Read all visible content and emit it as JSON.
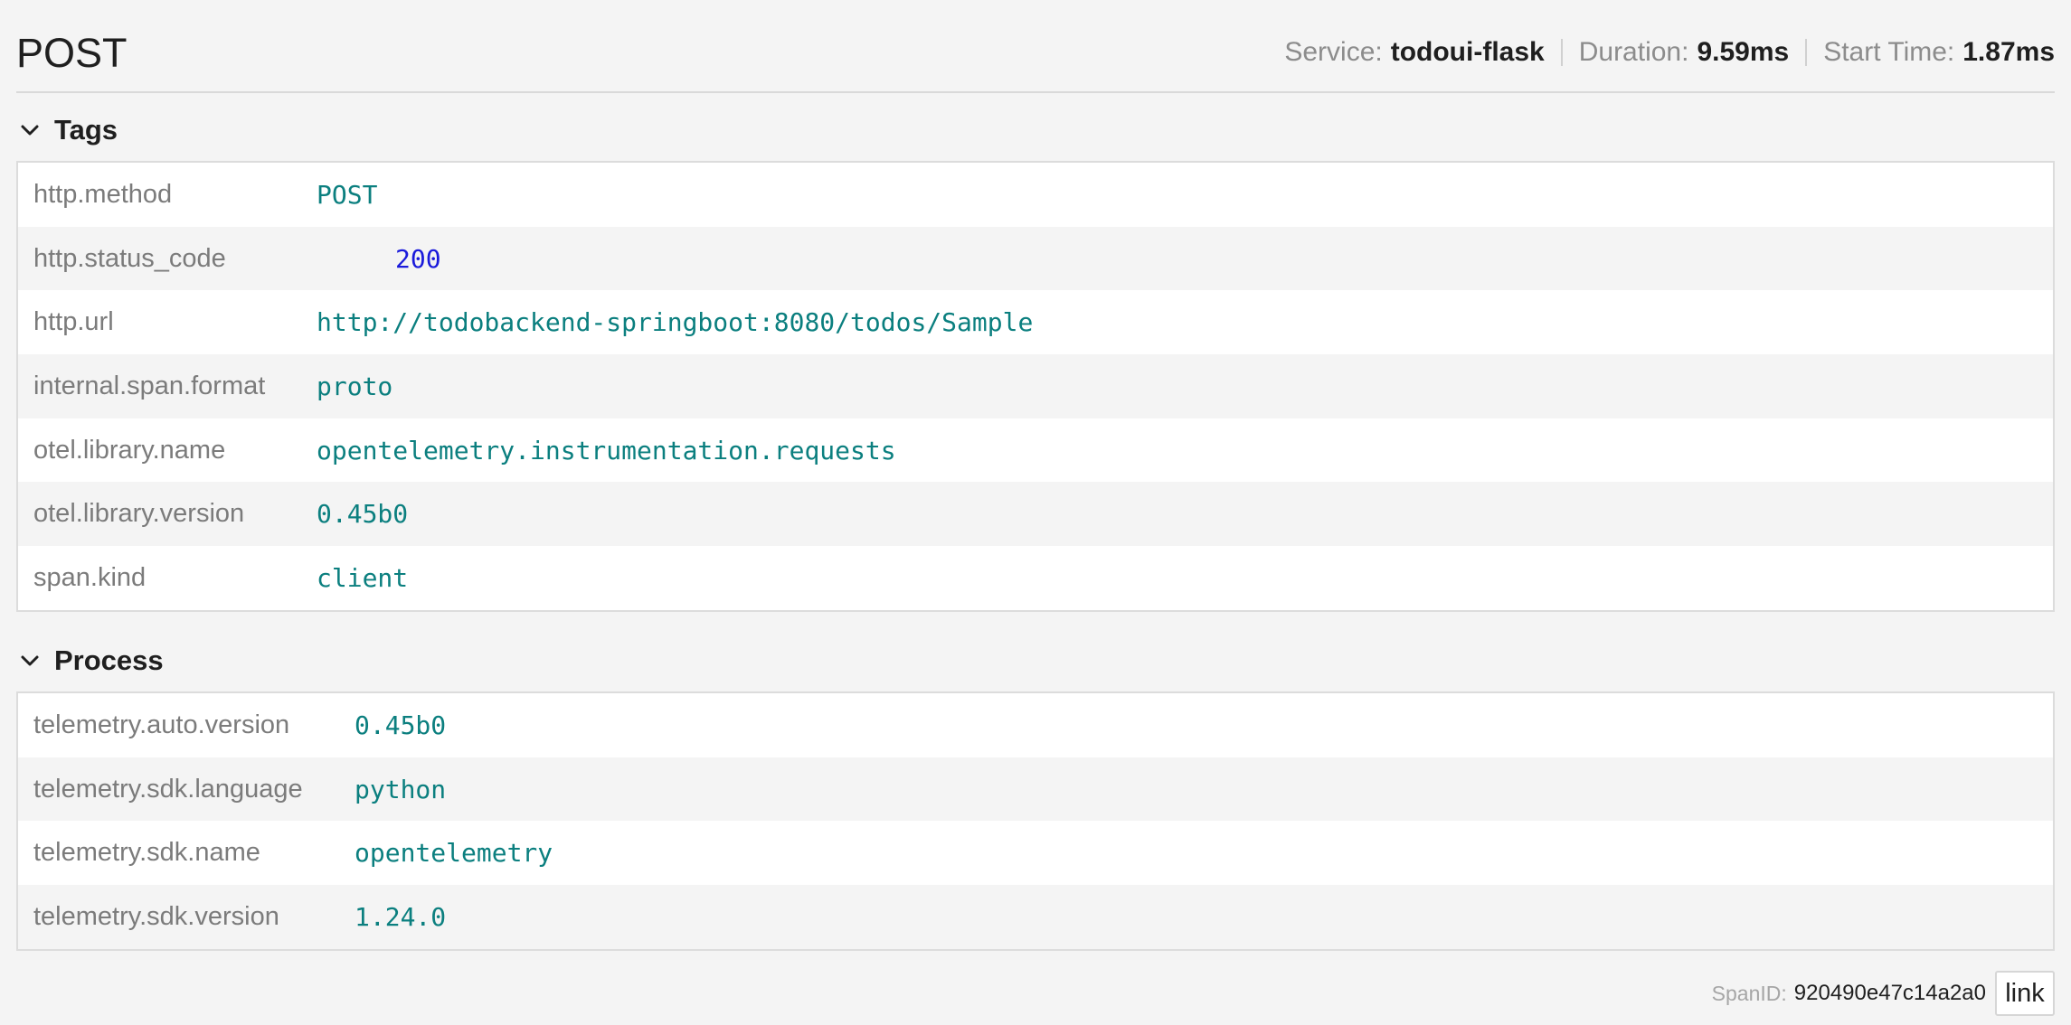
{
  "header": {
    "title": "POST",
    "service_label": "Service:",
    "service_value": "todoui-flask",
    "duration_label": "Duration:",
    "duration_value": "9.59ms",
    "start_label": "Start Time:",
    "start_value": "1.87ms"
  },
  "tags": {
    "title": "Tags",
    "rows": [
      {
        "key": "http.method",
        "value": "POST"
      },
      {
        "key": "http.status_code",
        "value": "200"
      },
      {
        "key": "http.url",
        "value": "http://todobackend-springboot:8080/todos/Sample"
      },
      {
        "key": "internal.span.format",
        "value": "proto"
      },
      {
        "key": "otel.library.name",
        "value": "opentelemetry.instrumentation.requests"
      },
      {
        "key": "otel.library.version",
        "value": "0.45b0"
      },
      {
        "key": "span.kind",
        "value": "client"
      }
    ]
  },
  "process": {
    "title": "Process",
    "rows": [
      {
        "key": "telemetry.auto.version",
        "value": "0.45b0"
      },
      {
        "key": "telemetry.sdk.language",
        "value": "python"
      },
      {
        "key": "telemetry.sdk.name",
        "value": "opentelemetry"
      },
      {
        "key": "telemetry.sdk.version",
        "value": "1.24.0"
      }
    ]
  },
  "footer": {
    "span_id_label": "SpanID:",
    "span_id_value": "920490e47c14a2a0",
    "link_label": "link"
  },
  "icons": {
    "tags_toggle": "chevron-down-icon",
    "process_toggle": "chevron-down-icon"
  },
  "colors": {
    "tag_value": "#0b7f7f",
    "numeric_value": "#1a1adb",
    "key_text": "#7b7b7b",
    "background": "#f4f4f4"
  }
}
